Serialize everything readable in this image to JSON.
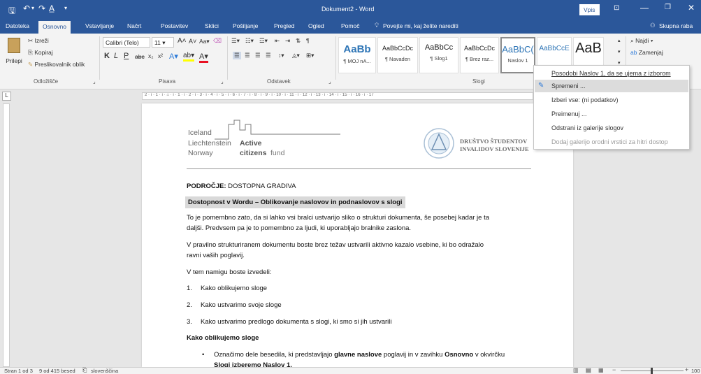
{
  "titlebar": {
    "title": "Dokument2 - Word",
    "signin": "Vpis"
  },
  "tabs": [
    "Datoteka",
    "Osnovno",
    "Vstavljanje",
    "Načrt",
    "Postavitev",
    "Sklici",
    "Pošiljanje",
    "Pregled",
    "Ogled",
    "Pomoč"
  ],
  "tellme": "Povejte mi, kaj želite narediti",
  "share": "Skupna raba",
  "clipboard": {
    "paste": "Prilepi",
    "cut": "Izreži",
    "copy": "Kopiraj",
    "format_painter": "Preslikovalnik oblik",
    "group": "Odložišče"
  },
  "font": {
    "name": "Calibri (Telo)",
    "size": "11",
    "group": "Pisava"
  },
  "paragraph": {
    "group": "Odstavek"
  },
  "styles": {
    "group": "Slogi",
    "items": [
      {
        "preview": "AaBb",
        "name": "¶ MOJ nA..."
      },
      {
        "preview": "AaBbCcDc",
        "name": "¶ Navaden"
      },
      {
        "preview": "AaBbCc",
        "name": "¶ Slog1"
      },
      {
        "preview": "AaBbCcDc",
        "name": "¶ Brez raz..."
      },
      {
        "preview": "AaBbC(",
        "name": "Naslov 1"
      },
      {
        "preview": "AaBbCcE",
        "name": ""
      },
      {
        "preview": "AaB",
        "name": ""
      }
    ]
  },
  "editing": {
    "find": "Najdi",
    "replace": "Zamenjaj"
  },
  "menu": {
    "items": [
      {
        "label": "Posodobi Naslov 1, da se ujema z izborom",
        "disabled": false
      },
      {
        "label": "Spremeni ...",
        "disabled": false
      },
      {
        "label": "Izberi vse: (ni podatkov)",
        "disabled": false
      },
      {
        "label": "Preimenuj ...",
        "disabled": false
      },
      {
        "label": "Odstrani iz galerije slogov",
        "disabled": false
      },
      {
        "label": "Dodaj galerijo orodni vrstici za hitri dostop",
        "disabled": true
      }
    ]
  },
  "doc": {
    "logo_line1": "Iceland",
    "logo_line2": "Liechtenstein",
    "logo_line3": "Norway",
    "logo_active": "Active",
    "logo_fund1": "citizens",
    "logo_fund2": "fund",
    "org1": "DRUŠTVO ŠTUDENTOV",
    "org2": "INVALIDOV SLOVENIJE",
    "area_label": "PODROČJE:",
    "area_value": "DOSTOPNA GRADIVA",
    "heading": "Dostopnost v Wordu – Oblikovanje naslovov in podnaslovov s slogi",
    "p1a": "To je pomembno zato, da si lahko vsi bralci ustvarijo sliko o strukturi dokumenta, še posebej kadar je ta",
    "p1b": "daljši. Predvsem pa je to pomembno za ljudi, ki uporabljajo bralnike zaslona.",
    "p2a": "V pravilno strukturiranem dokumentu boste brez težav ustvarili aktivno kazalo vsebine, ki bo odražalo",
    "p2b": "ravni vaših poglavij.",
    "p3": "V tem namigu boste izvedeli:",
    "l1n": "1.",
    "l1": "Kako oblikujemo sloge",
    "l2n": "2.",
    "l2": "Kako ustvarimo svoje sloge",
    "l3n": "3.",
    "l3": "Kako ustvarimo predlogo dokumenta s slogi, ki smo si jih ustvarili",
    "h2": "Kako oblikujemo sloge",
    "b1a": "Označimo dele besedila, ki predstavljajo ",
    "b1b": "glavne naslove",
    "b1c": " poglavij in v zavihku ",
    "b1d": "Osnovno",
    "b1e": " v okvirčku",
    "b1f": "Slogi izberemo Naslov 1."
  },
  "status": {
    "page": "Stran 1 od 3",
    "words": "9 od 415 besed",
    "lang": "slovenščina",
    "zoom": "100"
  }
}
